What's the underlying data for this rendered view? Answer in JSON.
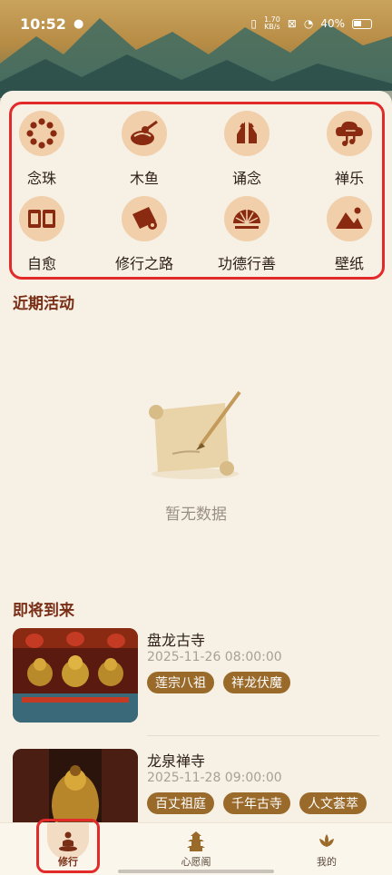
{
  "status_bar": {
    "time": "10:52",
    "speed_value": "1.70",
    "speed_unit": "KB/s",
    "battery": "40%"
  },
  "features": [
    {
      "label": "念珠",
      "icon": "prayer-beads-icon"
    },
    {
      "label": "木鱼",
      "icon": "wooden-fish-icon"
    },
    {
      "label": "诵念",
      "icon": "praying-hands-icon"
    },
    {
      "label": "禅乐",
      "icon": "music-cloud-icon"
    },
    {
      "label": "自愈",
      "icon": "scripture-cards-icon"
    },
    {
      "label": "修行之路",
      "icon": "scroll-icon"
    },
    {
      "label": "功德行善",
      "icon": "fan-icon"
    },
    {
      "label": "壁纸",
      "icon": "mountain-icon"
    }
  ],
  "recent": {
    "title": "近期活动",
    "empty_text": "暂无数据"
  },
  "upcoming": {
    "title": "即将到来",
    "events": [
      {
        "title": "盘龙古寺",
        "time": "2025-11-26 08:00:00",
        "tags": [
          "莲宗八祖",
          "祥龙伏魔"
        ]
      },
      {
        "title": "龙泉禅寺",
        "time": "2025-11-28 09:00:00",
        "tags": [
          "百丈祖庭",
          "千年古寺",
          "人文荟萃"
        ]
      }
    ]
  },
  "nav": [
    {
      "label": "修行",
      "icon": "meditation-icon",
      "active": true
    },
    {
      "label": "心愿阁",
      "icon": "pagoda-icon",
      "active": false
    },
    {
      "label": "我的",
      "icon": "lotus-icon",
      "active": false
    }
  ],
  "colors": {
    "accent": "#7a2e16",
    "icon_bg": "#f1cfaa",
    "tag_bg": "#9a6a2b",
    "highlight": "#e32a2a"
  }
}
